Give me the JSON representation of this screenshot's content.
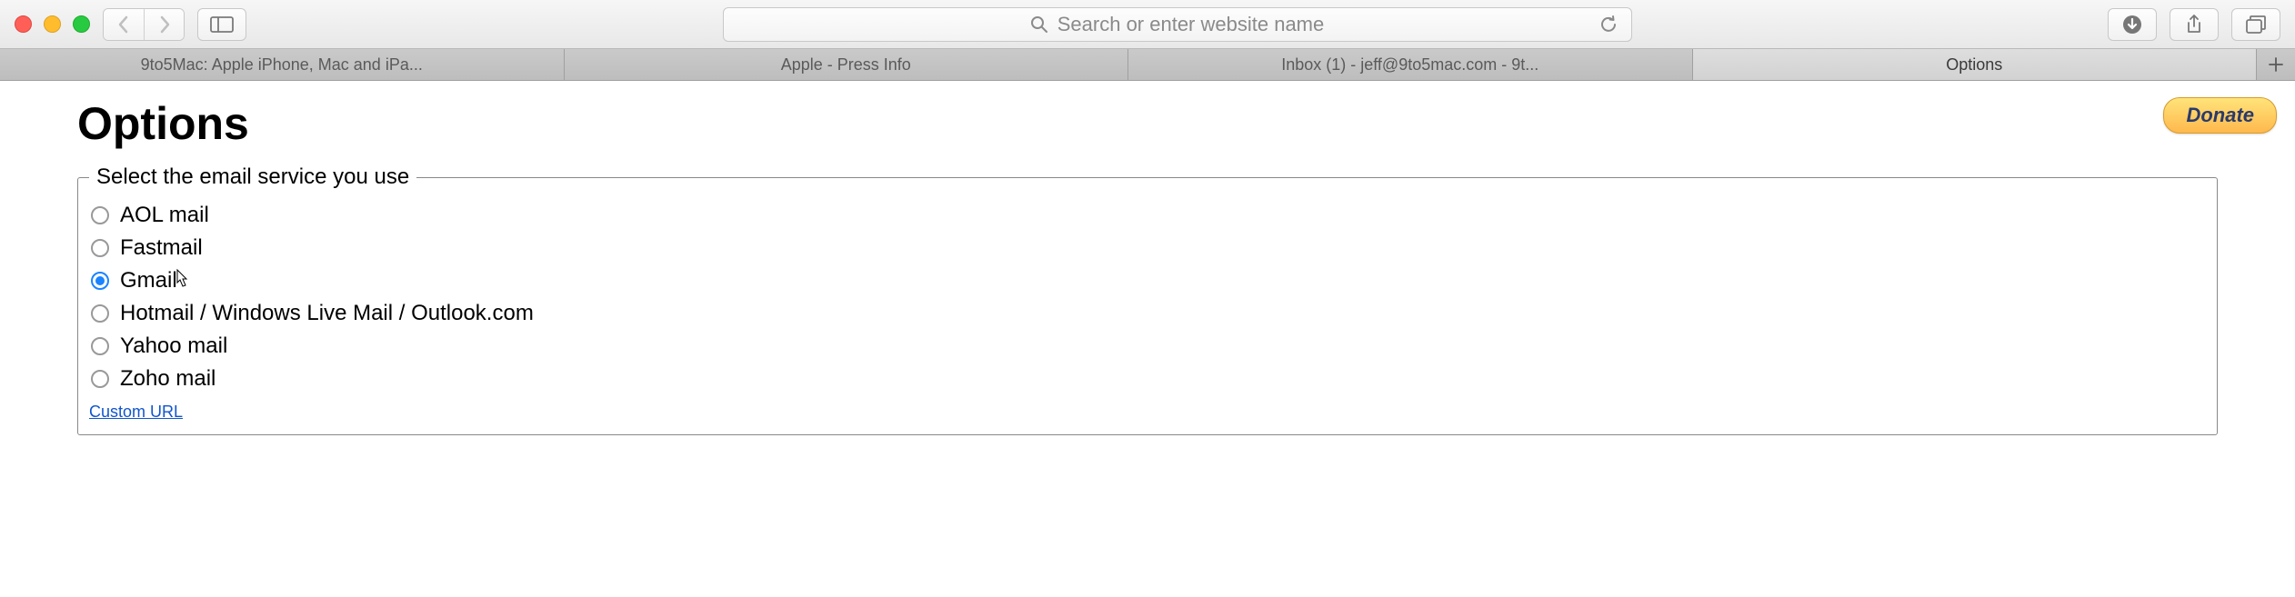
{
  "toolbar": {
    "url_placeholder": "Search or enter website name"
  },
  "tabs": [
    {
      "label": "9to5Mac: Apple iPhone, Mac and iPa...",
      "active": false
    },
    {
      "label": "Apple - Press Info",
      "active": false
    },
    {
      "label": "Inbox (1) - jeff@9to5mac.com - 9t...",
      "active": false
    },
    {
      "label": "Options",
      "active": true
    }
  ],
  "page": {
    "title": "Options",
    "donate_label": "Donate",
    "fieldset_legend": "Select the email service you use",
    "custom_url_label": "Custom URL"
  },
  "services": [
    {
      "label": "AOL mail",
      "checked": false
    },
    {
      "label": "Fastmail",
      "checked": false
    },
    {
      "label": "Gmail",
      "checked": true
    },
    {
      "label": "Hotmail / Windows Live Mail / Outlook.com",
      "checked": false
    },
    {
      "label": "Yahoo mail",
      "checked": false
    },
    {
      "label": "Zoho mail",
      "checked": false
    }
  ]
}
